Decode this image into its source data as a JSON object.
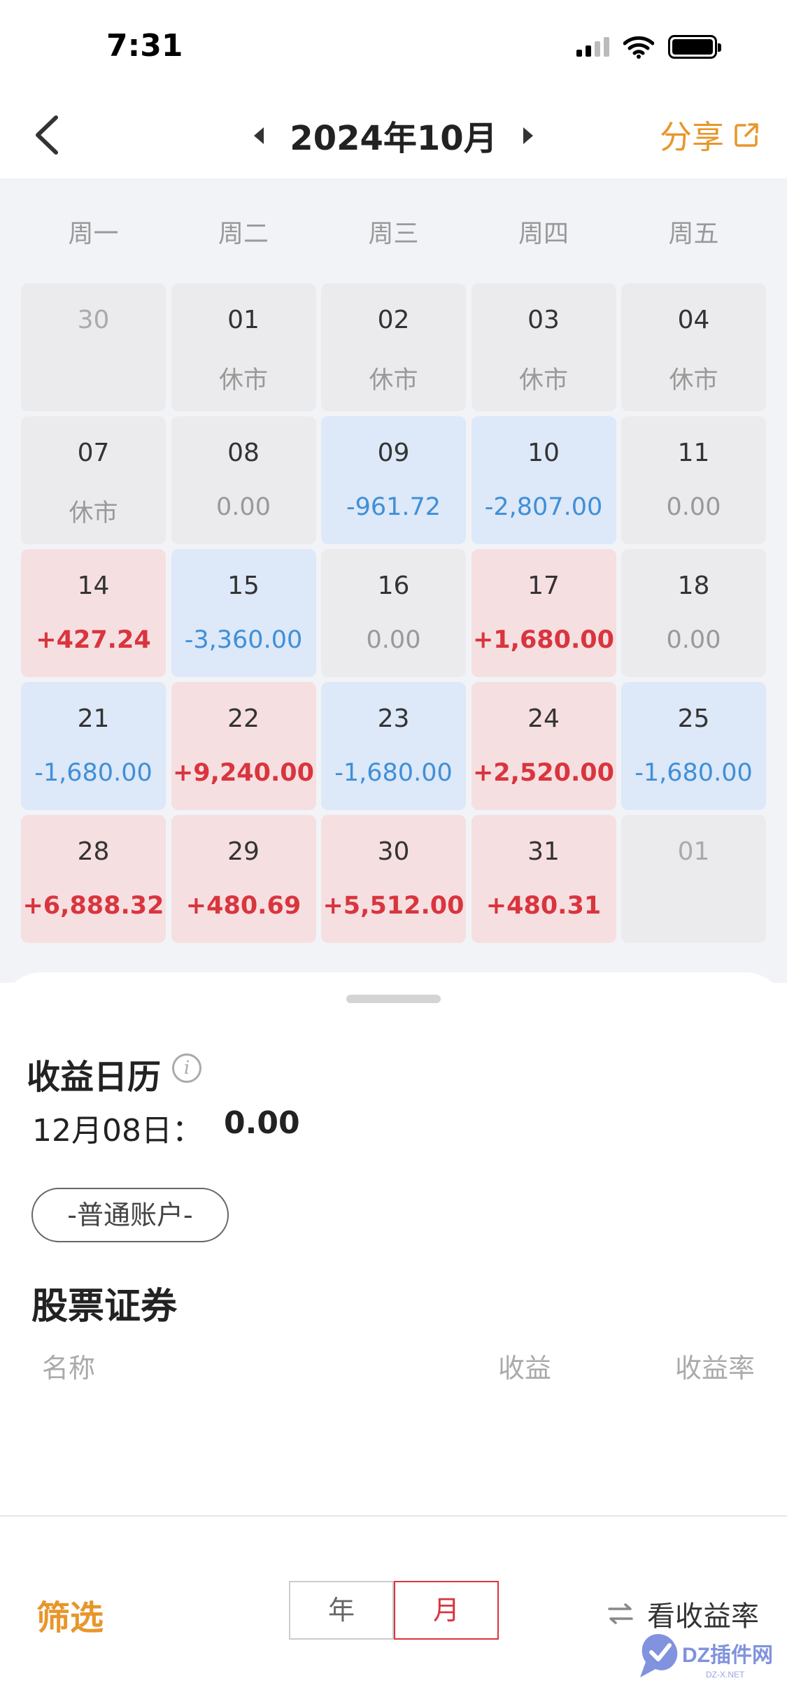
{
  "status_bar": {
    "time": "7:31"
  },
  "header": {
    "title": "2024年10月",
    "share_label": "分享"
  },
  "calendar": {
    "weekdays": [
      "周一",
      "周二",
      "周三",
      "周四",
      "周五"
    ],
    "cells": [
      {
        "day": "30",
        "value": "",
        "state": "other"
      },
      {
        "day": "01",
        "value": "休市",
        "state": "closed"
      },
      {
        "day": "02",
        "value": "休市",
        "state": "closed"
      },
      {
        "day": "03",
        "value": "休市",
        "state": "closed"
      },
      {
        "day": "04",
        "value": "休市",
        "state": "closed"
      },
      {
        "day": "07",
        "value": "休市",
        "state": "closed"
      },
      {
        "day": "08",
        "value": "0.00",
        "state": "flat"
      },
      {
        "day": "09",
        "value": "-961.72",
        "state": "loss"
      },
      {
        "day": "10",
        "value": "-2,807.00",
        "state": "loss"
      },
      {
        "day": "11",
        "value": "0.00",
        "state": "flat"
      },
      {
        "day": "14",
        "value": "+427.24",
        "state": "gain"
      },
      {
        "day": "15",
        "value": "-3,360.00",
        "state": "loss"
      },
      {
        "day": "16",
        "value": "0.00",
        "state": "flat"
      },
      {
        "day": "17",
        "value": "+1,680.00",
        "state": "gain"
      },
      {
        "day": "18",
        "value": "0.00",
        "state": "flat"
      },
      {
        "day": "21",
        "value": "-1,680.00",
        "state": "loss"
      },
      {
        "day": "22",
        "value": "+9,240.00",
        "state": "gain"
      },
      {
        "day": "23",
        "value": "-1,680.00",
        "state": "loss"
      },
      {
        "day": "24",
        "value": "+2,520.00",
        "state": "gain"
      },
      {
        "day": "25",
        "value": "-1,680.00",
        "state": "loss"
      },
      {
        "day": "28",
        "value": "+6,888.32",
        "state": "gain"
      },
      {
        "day": "29",
        "value": "+480.69",
        "state": "gain"
      },
      {
        "day": "30",
        "value": "+5,512.00",
        "state": "gain"
      },
      {
        "day": "31",
        "value": "+480.31",
        "state": "gain"
      },
      {
        "day": "01",
        "value": "",
        "state": "other"
      }
    ]
  },
  "sheet": {
    "title": "收益日历",
    "info_glyph": "i",
    "date_label": "12月08日：",
    "date_value": "0.00",
    "account_label": "-普通账户-",
    "section_title": "股票证券",
    "columns": {
      "name": "名称",
      "profit": "收益",
      "rate": "收益率"
    }
  },
  "footer": {
    "filter_label": "筛选",
    "segments": [
      {
        "label": "年",
        "active": false
      },
      {
        "label": "月",
        "active": true
      }
    ],
    "toggle_label": "看收益率"
  },
  "watermark": {
    "text": "DZ插件网",
    "subtext": "DZ-X.NET"
  },
  "colors": {
    "accent": "#e8962a",
    "gain": "#d9353e",
    "loss": "#3f8fd8",
    "gain_bg": "#f6dfe1",
    "loss_bg": "#dde8f8"
  }
}
